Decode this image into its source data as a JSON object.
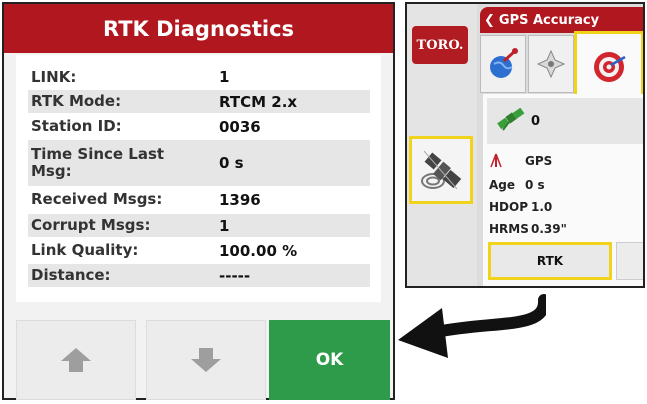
{
  "dialog": {
    "title": "RTK Diagnostics",
    "rows": [
      {
        "label": "LINK:",
        "value": "1"
      },
      {
        "label": "RTK Mode:",
        "value": "RTCM 2.x"
      },
      {
        "label": "Station ID:",
        "value": "0036"
      },
      {
        "label": "Time Since Last Msg:",
        "value": "0 s"
      },
      {
        "label": "Received Msgs:",
        "value": "1396"
      },
      {
        "label": "Corrupt Msgs:",
        "value": "1"
      },
      {
        "label": "Link Quality:",
        "value": "100.00 %"
      },
      {
        "label": "Distance:",
        "value": "-----"
      }
    ],
    "up_icon": "arrow-up-icon",
    "down_icon": "arrow-down-icon",
    "ok_label": "OK"
  },
  "screen": {
    "logo": "TORO.",
    "title": "GPS Accuracy",
    "back_icon": "chevron-left-icon",
    "tabs": [
      "globe-pin-icon",
      "satellite-icon",
      "target-icon"
    ],
    "satellite_count": "0",
    "source_label": "GPS",
    "age_label": "Age",
    "age_value": "0 s",
    "hdop_label": "HDOP",
    "hdop_value": "1.0",
    "hrms_label": "HRMS",
    "hrms_value": "0.39\"",
    "rtk_label": "RTK",
    "side_button_icon": "gps-receiver-icon"
  },
  "colors": {
    "header_red": "#b0171f",
    "ok_green": "#2e9b4a",
    "highlight_yellow": "#f2d31c"
  }
}
